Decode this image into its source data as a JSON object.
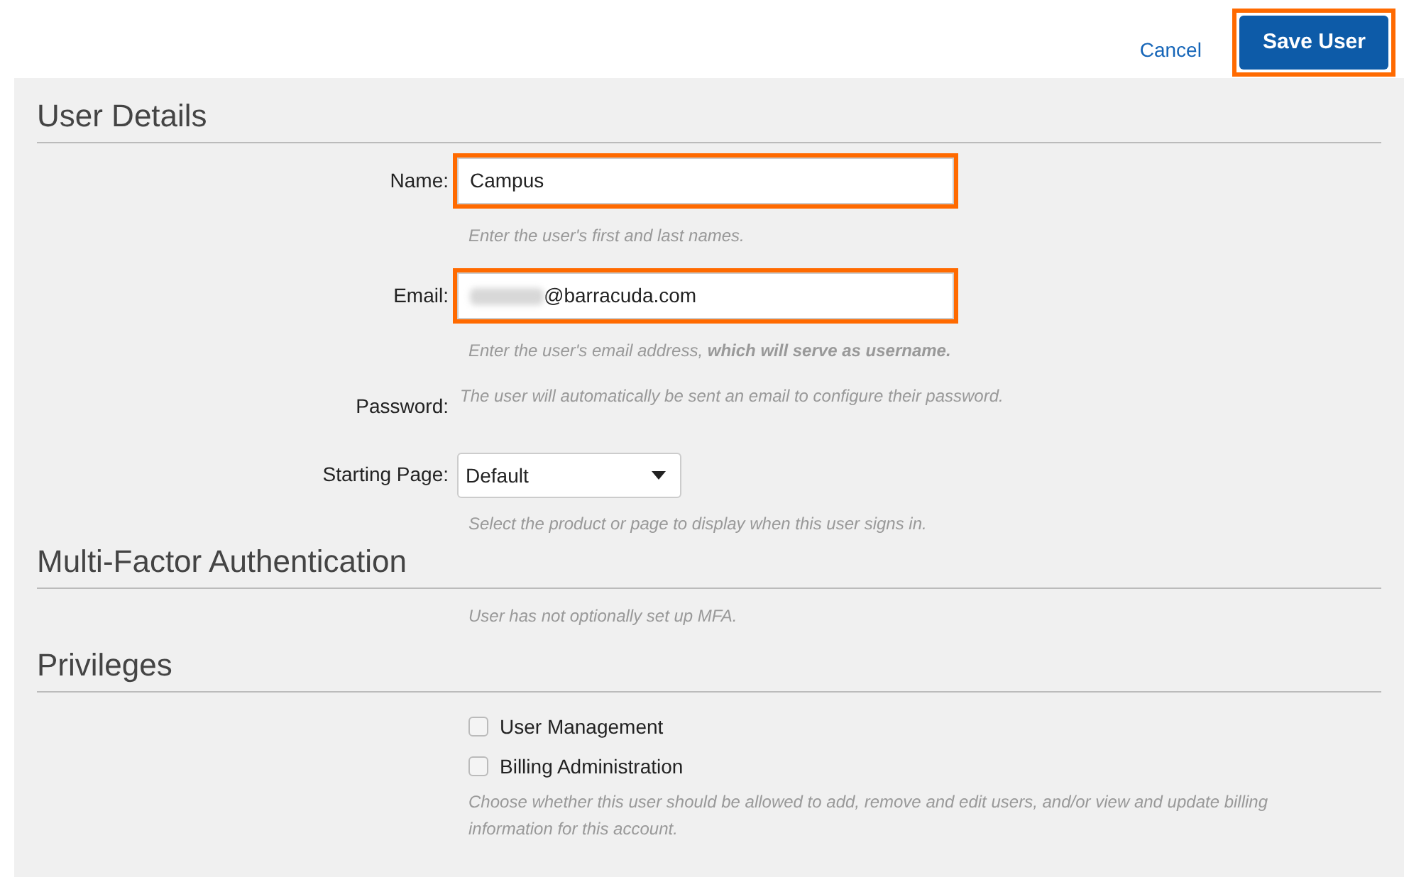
{
  "actions": {
    "cancel": "Cancel",
    "save": {
      "label": "Save User",
      "highlighted": true
    }
  },
  "sections": [
    {
      "title": "User Details",
      "rows": [
        {
          "kind": "text",
          "label": "Name:",
          "value": "Campus",
          "highlighted": true,
          "hint": "Enter the user's first and last names."
        },
        {
          "kind": "email",
          "label": "Email:",
          "value": "@barracuda.com",
          "redacted": true,
          "highlighted": true,
          "hint": "Enter the user's email address, **which will serve as username.**"
        },
        {
          "kind": "note",
          "label": "Password:",
          "hint": "The user will automatically be sent an email to configure their password."
        },
        {
          "kind": "select",
          "label": "Starting Page:",
          "value": "Default",
          "hint": "Select the product or page to display when this user signs in."
        }
      ]
    },
    {
      "title": "Multi-Factor Authentication",
      "rows": [
        {
          "kind": "hint",
          "hint": "User has not optionally set up MFA."
        }
      ]
    },
    {
      "title": "Privileges",
      "rows": [
        {
          "kind": "checkbox",
          "label": "User Management",
          "checked": false
        },
        {
          "kind": "checkbox",
          "label": "Billing Administration",
          "checked": false
        },
        {
          "kind": "hint",
          "hint": "Choose whether this user should be allowed to add, remove and edit users, and/or view and update billing information for this account."
        }
      ]
    }
  ]
}
